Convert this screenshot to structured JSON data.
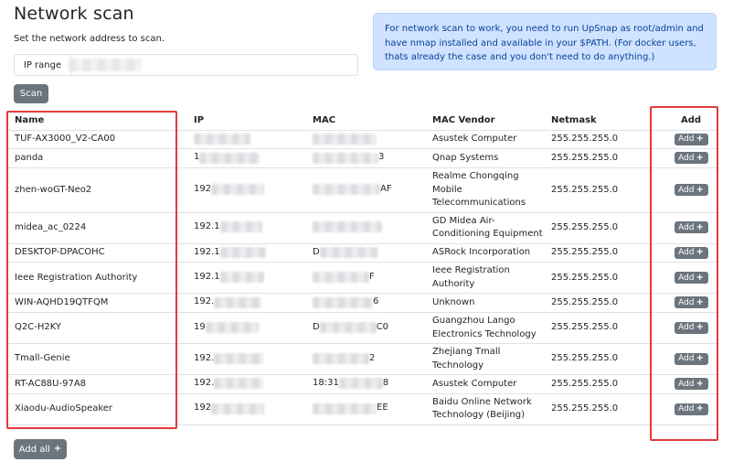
{
  "page": {
    "title": "Network scan",
    "subtitle": "Set the network address to scan."
  },
  "ip_range": {
    "label": "IP range",
    "value": ""
  },
  "scan_button": {
    "label": "Scan"
  },
  "info_message": "For network scan to work, you need to run UpSnap as root/admin and have nmap installed and available in your $PATH. (For docker users, thats already the case and you don't need to do anything.)",
  "table": {
    "headers": {
      "name": "Name",
      "ip": "IP",
      "mac": "MAC",
      "vendor": "MAC Vendor",
      "netmask": "Netmask",
      "add": "Add"
    },
    "add_label": "Add",
    "rows": [
      {
        "name": "TUF-AX3000_V2-CA00",
        "ip_prefix": "",
        "mac_prefix": "",
        "mac_suffix": "",
        "vendor": "Asustek Computer",
        "netmask": "255.255.255.0"
      },
      {
        "name": "panda",
        "ip_prefix": "1",
        "mac_prefix": "",
        "mac_suffix": "3",
        "vendor": "Qnap Systems",
        "netmask": "255.255.255.0"
      },
      {
        "name": "zhen-woGT-Neo2",
        "ip_prefix": "192",
        "mac_prefix": "",
        "mac_suffix": "AF",
        "vendor": "Realme Chongqing Mobile Telecommunications",
        "netmask": "255.255.255.0"
      },
      {
        "name": "midea_ac_0224",
        "ip_prefix": "192.1",
        "mac_prefix": "",
        "mac_suffix": "",
        "vendor": "GD Midea Air-Conditioning Equipment",
        "netmask": "255.255.255.0"
      },
      {
        "name": "DESKTOP-DPACOHC",
        "ip_prefix": "192.1",
        "mac_prefix": "D",
        "mac_suffix": "",
        "vendor": "ASRock Incorporation",
        "netmask": "255.255.255.0"
      },
      {
        "name": "Ieee Registration Authority",
        "ip_prefix": "192.1",
        "mac_prefix": "",
        "mac_suffix": "F",
        "vendor": "Ieee Registration Authority",
        "netmask": "255.255.255.0"
      },
      {
        "name": "WIN-AQHD19QTFQM",
        "ip_prefix": "192.",
        "mac_prefix": "",
        "mac_suffix": "6",
        "vendor": "Unknown",
        "netmask": "255.255.255.0"
      },
      {
        "name": "Q2C-H2KY",
        "ip_prefix": "19",
        "mac_prefix": "D",
        "mac_suffix": "C0",
        "vendor": "Guangzhou Lango Electronics Technology",
        "netmask": "255.255.255.0"
      },
      {
        "name": "Tmall-Genie",
        "ip_prefix": "192.",
        "mac_prefix": "",
        "mac_suffix": "2",
        "vendor": "Zhejiang Tmall Technology",
        "netmask": "255.255.255.0"
      },
      {
        "name": "RT-AC88U-97A8",
        "ip_prefix": "192.",
        "mac_prefix": "18:31",
        "mac_suffix": "8",
        "vendor": "Asustek Computer",
        "netmask": "255.255.255.0"
      },
      {
        "name": "Xiaodu-AudioSpeaker",
        "ip_prefix": "192",
        "mac_prefix": "",
        "mac_suffix": "EE",
        "vendor": "Baidu Online Network Technology (Beijing)",
        "netmask": "255.255.255.0"
      }
    ]
  },
  "add_all_button": {
    "label": "Add all"
  },
  "colors": {
    "button_bg": "#6c757d",
    "info_bg": "#cfe2ff",
    "info_text": "#084298",
    "highlight_box": "#e03a3a"
  }
}
